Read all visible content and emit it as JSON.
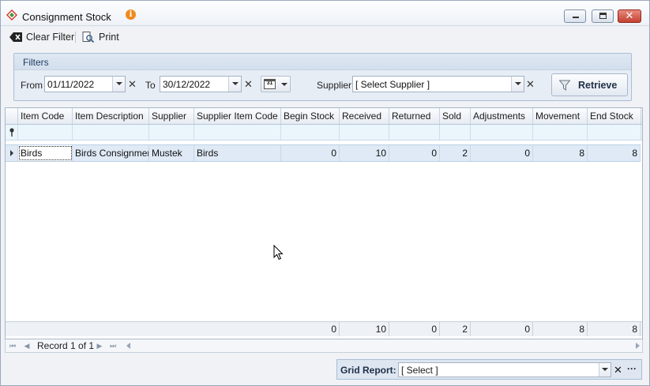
{
  "window": {
    "title": "Consignment Stock",
    "info_icon": "i",
    "close_glyph": "✕"
  },
  "toolbar": {
    "clear_filter_label": "Clear Filter",
    "print_label": "Print"
  },
  "filters": {
    "title": "Filters",
    "from_label": "From",
    "from_value": "01/11/2022",
    "to_label": "To",
    "to_value": "30/12/2022",
    "calendar_icon_text": "31",
    "supplier_label": "Supplier",
    "supplier_value": "[ Select Supplier ]",
    "clear_glyph": "✕",
    "retrieve_label": "Retrieve"
  },
  "grid": {
    "columns": [
      "Item Code",
      "Item Description",
      "Supplier",
      "Supplier Item Code",
      "Begin Stock",
      "Received",
      "Returned",
      "Sold",
      "Adjustments",
      "Movement",
      "End Stock"
    ],
    "rows": [
      [
        "Birds",
        "Birds Consignment",
        "Mustek",
        "Birds",
        "0",
        "10",
        "0",
        "2",
        "0",
        "8",
        "8"
      ]
    ],
    "totals": [
      "0",
      "10",
      "0",
      "2",
      "0",
      "8",
      "8"
    ]
  },
  "navigator": {
    "record_text": "Record 1 of 1",
    "first": "⏮",
    "prev": "◀",
    "next": "▶",
    "last": "⏭"
  },
  "grid_report": {
    "label": "Grid Report:",
    "value": "[ Select ]",
    "clear_glyph": "✕",
    "more_glyph": "···"
  }
}
